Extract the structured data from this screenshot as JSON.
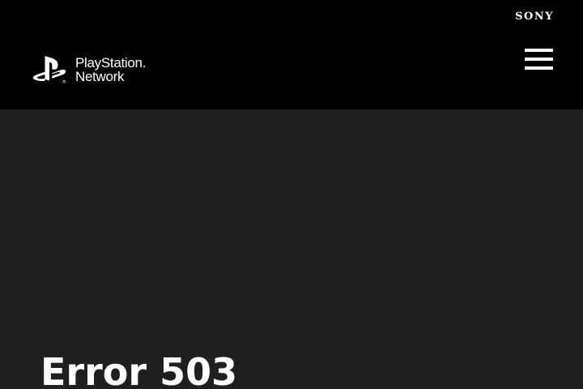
{
  "header": {
    "brand": "SONY",
    "logo": {
      "line1": "PlayStation.",
      "line2": "Network",
      "icon": "playstation-logo-icon"
    },
    "menu_icon": "hamburger-menu-icon"
  },
  "main": {
    "title": "Error 503"
  },
  "colors": {
    "header_bg": "#000000",
    "page_bg": "#1f1f1f",
    "text": "#ffffff"
  }
}
